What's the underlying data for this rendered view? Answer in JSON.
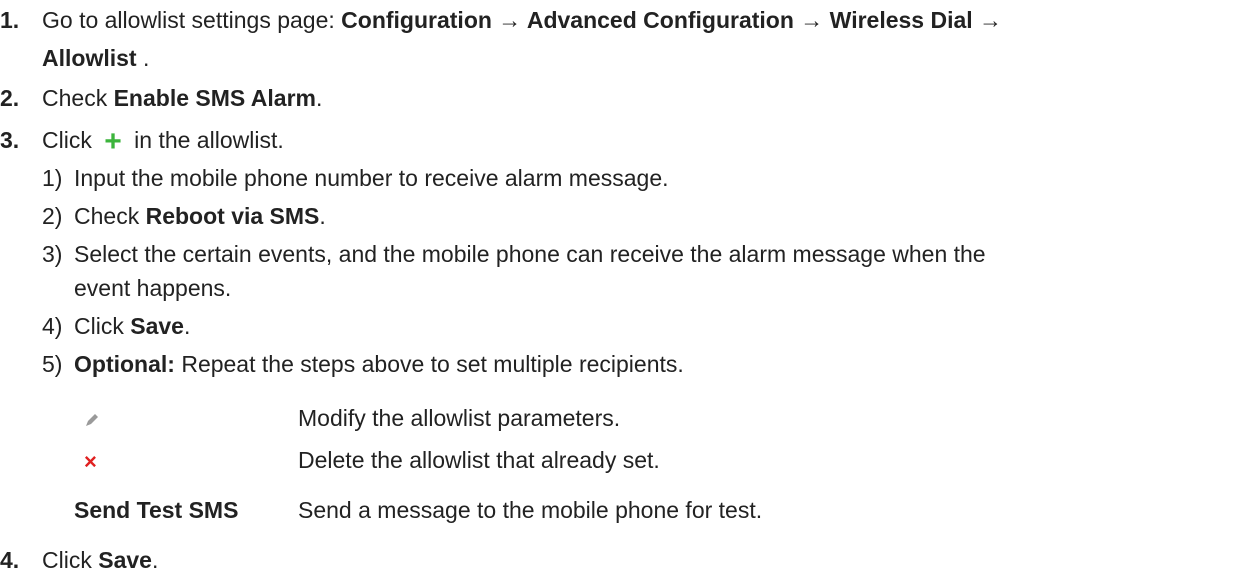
{
  "steps": [
    {
      "number": "1.",
      "text_before": "Go to allowlist settings page: ",
      "path_bold": "Configuration → Advanced Configuration → Wireless Dial →",
      "path_bold_cont": "Allowlist",
      "text_after": " ."
    },
    {
      "number": "2.",
      "text_before": "Check ",
      "bold": "Enable SMS Alarm",
      "text_after": "."
    },
    {
      "number": "3.",
      "text_before": "Click ",
      "icon": "plus-icon",
      "text_after": " in the allowlist.",
      "substeps": [
        {
          "number": "1)",
          "text": "Input the mobile phone number to receive alarm message."
        },
        {
          "number": "2)",
          "text_before": "Check ",
          "bold": "Reboot via SMS",
          "text_after": "."
        },
        {
          "number": "3)",
          "text": "Select the certain events, and the mobile phone can receive the alarm message when the",
          "text_cont": "event happens."
        },
        {
          "number": "4)",
          "text_before": "Click ",
          "bold": "Save",
          "text_after": "."
        },
        {
          "number": "5)",
          "bold": "Optional:",
          "text_after": " Repeat the steps above to set multiple recipients."
        }
      ]
    },
    {
      "number": "4.",
      "text_before": "Click ",
      "bold": "Save",
      "text_after": "."
    }
  ],
  "definitions": [
    {
      "icon": "pencil-icon",
      "description": "Modify the allowlist parameters."
    },
    {
      "icon": "delete-icon",
      "description": "Delete the allowlist that already set."
    },
    {
      "term": "Send Test SMS",
      "description": "Send a message to the mobile phone for test."
    }
  ],
  "colors": {
    "plus_icon": "#3cb43c",
    "delete_icon": "#e02020",
    "pencil_icon": "#9a9a9a",
    "text": "#222222"
  }
}
